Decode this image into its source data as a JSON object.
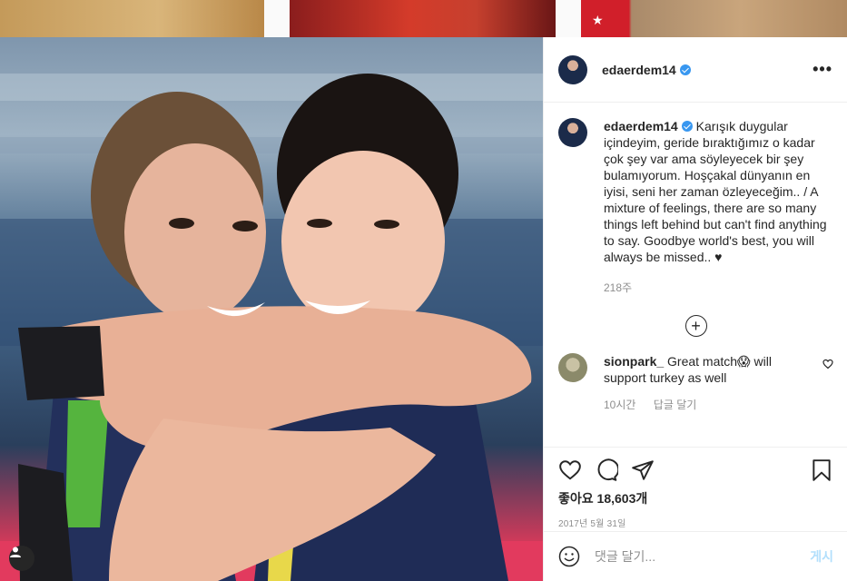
{
  "post": {
    "username": "edaerdem14",
    "verified": true,
    "caption": "Karışık duygular içindeyim, geride bıraktığımız o kadar çok şey var ama söyleyecek bir şey bulamıyorum. Hoşçakal dünyanın en iyisi, seni her zaman özleyeceğim.. / A mixture of feelings, there are so many things left behind but can't find anything to say. Goodbye world's best, you will always be missed.. ♥",
    "caption_age": "218주",
    "likes": "좋아요 18,603개",
    "date": "2017년 5월 31일"
  },
  "comment": {
    "username": "sionpark_",
    "text": "Great match😱 will support turkey as well",
    "age": "10시간",
    "reply_label": "답글 달기"
  },
  "composer": {
    "placeholder": "댓글 달기...",
    "post_label": "게시"
  },
  "icons": {
    "more": "more-options-icon",
    "plus": "load-more-icon",
    "heart": "heart-icon",
    "comment": "comment-icon",
    "share": "share-icon",
    "save": "bookmark-icon",
    "emoji": "emoji-icon"
  },
  "colors": {
    "verified": "#3897f0",
    "muted_text": "#8e8e8e",
    "post_button_disabled": "#b2dffc"
  }
}
